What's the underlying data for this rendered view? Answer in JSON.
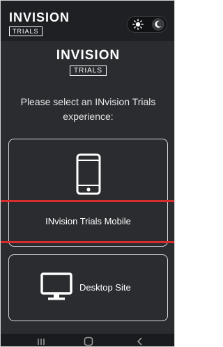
{
  "header": {
    "brand_wordmark": "INVISION",
    "brand_tag": "TRIALS",
    "theme_toggle": {
      "light_icon": "sun-icon",
      "dark_icon": "moon-icon",
      "active": "dark"
    }
  },
  "hero": {
    "wordmark": "INVISION",
    "tag": "TRIALS"
  },
  "prompt": "Please select an INvision Trials experience:",
  "options": [
    {
      "label": "INvision Trials Mobile",
      "icon": "smartphone-icon"
    },
    {
      "label": "Desktop Site",
      "icon": "monitor-icon"
    }
  ],
  "system_nav": {
    "recent_icon": "recent-apps-icon",
    "home_icon": "home-icon",
    "back_icon": "back-icon"
  },
  "colors": {
    "background": "#2a2c30",
    "header": "#1e2024",
    "card_border": "#d8d8d8",
    "highlight_line": "#d92d2d",
    "text": "#ffffff"
  }
}
